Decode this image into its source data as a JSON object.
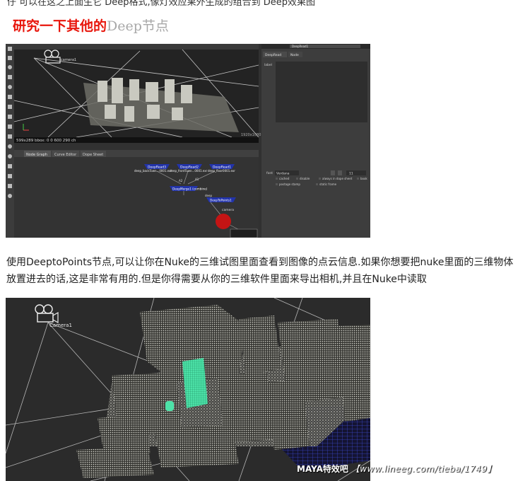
{
  "top_partial_text": "仔 可以在这之上面生它 Deep格式,像灯效应果外生成的组合到 Deep效果图",
  "heading": {
    "red": "研究一下其他的",
    "gray": "Deep节点"
  },
  "nuke_ui": {
    "viewer_info": "599x289 bbox: 0 0 600 290 ch",
    "viewer_format": "1920x1080",
    "camera_label": "camera1",
    "tabs": [
      "Node Graph",
      "Curve Editor",
      "Dope Sheet"
    ],
    "props_header": "DeepRead1",
    "props_tabs": [
      "DeepRead",
      "Node"
    ],
    "props_label": "label",
    "font_label": "font",
    "font_value": "Verdana",
    "font_size": "11",
    "checks": [
      "cached",
      "disable",
      "always in dope sheet",
      "book"
    ],
    "checks2": [
      "postage stamp",
      "static frame"
    ],
    "nodes": [
      {
        "title": "DeepRead3",
        "sub": "deep_backTown...0001.exr"
      },
      {
        "title": "DeepRead2",
        "sub": "deep_frontTown...0001.exr"
      },
      {
        "title": "DeepRead1",
        "sub": "deep_floor0001.exr"
      }
    ],
    "merge_node": "DeepMerge1 (combine)",
    "topoints_node": "DeepToPoints1",
    "camera_node": "camera",
    "pipe_labels": [
      "A2",
      "A1",
      "B",
      "deep"
    ]
  },
  "paragraph": "使用DeeptoPoints节点,可以让你在Nuke的三维试图里面查看到图像的点云信息.如果你想要把nuke里面的三维物体放置进去的话,这是非常有用的.但是你得需要从你的三维软件里面来导出相机,并且在Nuke中读取",
  "cloud_camera_label": "Camera1",
  "watermark": {
    "brand": "MAYA特效吧",
    "url": "【www.lineeg.com/tieba/1749】"
  }
}
